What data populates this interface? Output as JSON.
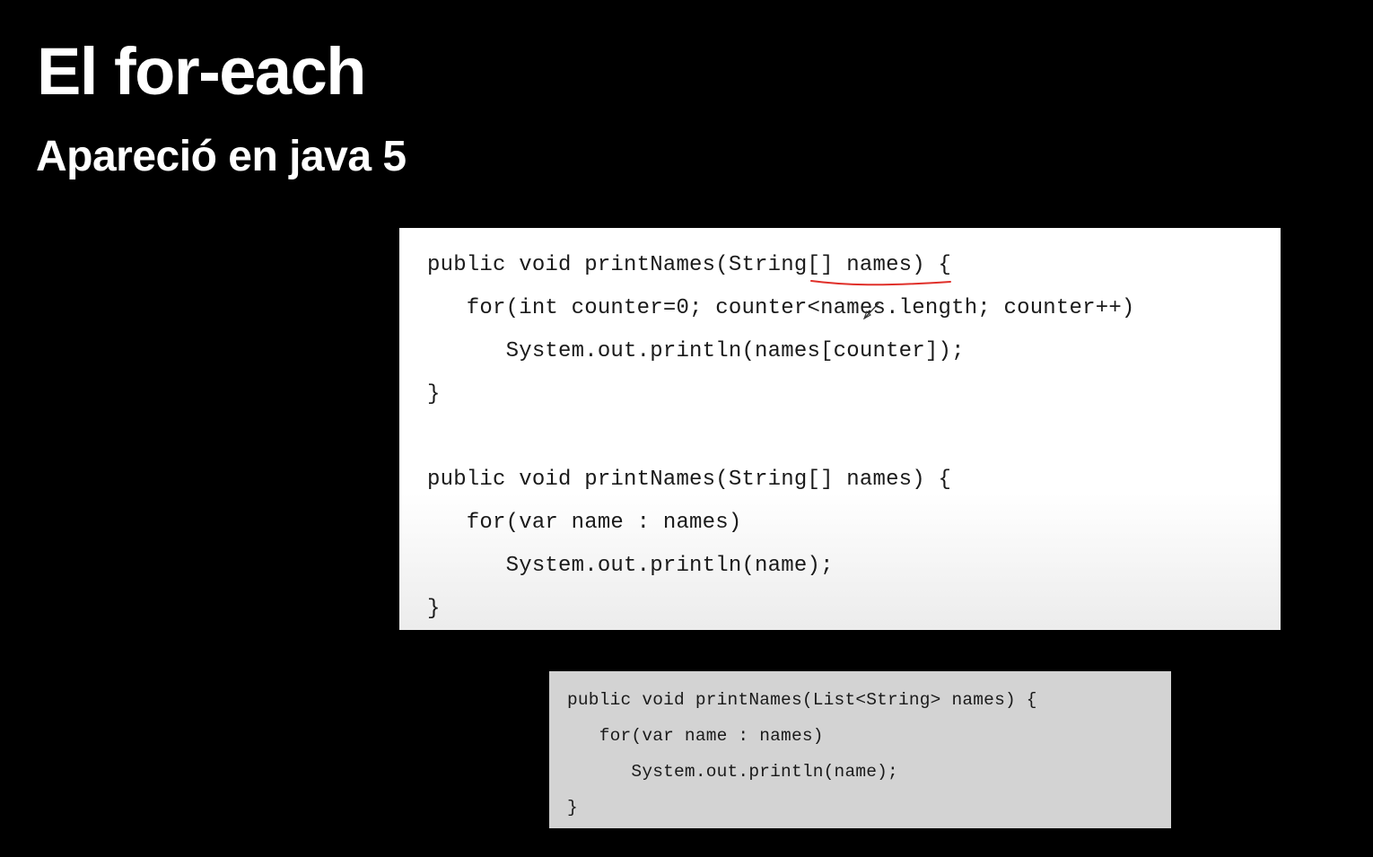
{
  "slide": {
    "title": "El for-each",
    "subtitle": "Apareció en java 5"
  },
  "code_blocks": [
    {
      "lines": [
        "public void printNames(String[] names) {",
        "   for(int counter=0; counter<names.length; counter++)",
        "      System.out.println(names[counter]);",
        "}",
        "public void printNames(String[] names) {",
        "   for(var name : names)",
        "      System.out.println(name);",
        "}"
      ],
      "annotation_color": "#e0302a",
      "background": "#ffffff"
    },
    {
      "lines": [
        "public void printNames(List<String> names) {",
        "   for(var name : names)",
        "      System.out.println(name);",
        "}"
      ],
      "background": "#d3d3d3"
    }
  ],
  "icons": {
    "cursor": "pen-cursor-icon"
  }
}
